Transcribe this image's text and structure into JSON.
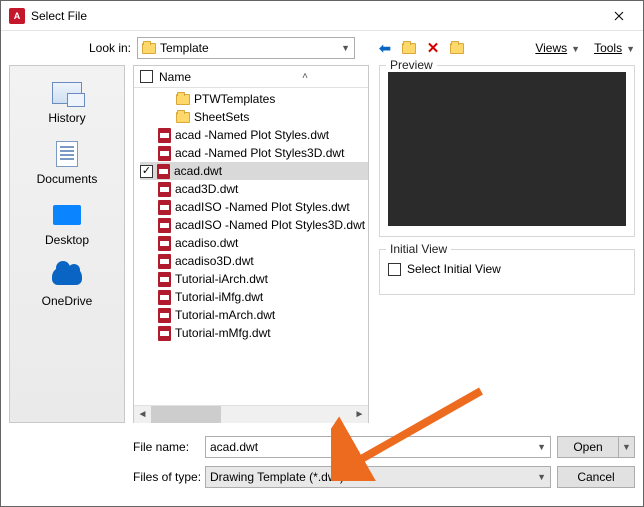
{
  "title": "Select File",
  "lookin_label": "Look in:",
  "lookin_value": "Template",
  "menus": {
    "views": "Views",
    "tools": "Tools"
  },
  "places": [
    {
      "icon": "history-icon",
      "label": "History"
    },
    {
      "icon": "doc-icon",
      "label": "Documents"
    },
    {
      "icon": "desktop-icon",
      "label": "Desktop"
    },
    {
      "icon": "onedrive-icon",
      "label": "OneDrive"
    }
  ],
  "columns": {
    "name": "Name"
  },
  "files": [
    {
      "type": "folder",
      "name": "PTWTemplates",
      "indent": true
    },
    {
      "type": "folder",
      "name": "SheetSets",
      "indent": true
    },
    {
      "type": "dwt",
      "name": "acad -Named Plot Styles.dwt"
    },
    {
      "type": "dwt",
      "name": "acad -Named Plot Styles3D.dwt"
    },
    {
      "type": "dwt",
      "name": "acad.dwt",
      "checked": true,
      "selected": true
    },
    {
      "type": "dwt",
      "name": "acad3D.dwt"
    },
    {
      "type": "dwt",
      "name": "acadISO -Named Plot Styles.dwt"
    },
    {
      "type": "dwt",
      "name": "acadISO -Named Plot Styles3D.dwt"
    },
    {
      "type": "dwt",
      "name": "acadiso.dwt"
    },
    {
      "type": "dwt",
      "name": "acadiso3D.dwt"
    },
    {
      "type": "dwt",
      "name": "Tutorial-iArch.dwt"
    },
    {
      "type": "dwt",
      "name": "Tutorial-iMfg.dwt"
    },
    {
      "type": "dwt",
      "name": "Tutorial-mArch.dwt"
    },
    {
      "type": "dwt",
      "name": "Tutorial-mMfg.dwt"
    }
  ],
  "preview_label": "Preview",
  "initial_view_label": "Initial View",
  "initial_view_checkbox": "Select Initial View",
  "filename_label": "File name:",
  "filename_value": "acad.dwt",
  "filetype_label": "Files of type:",
  "filetype_value": "Drawing Template (*.dwt)",
  "open_label": "Open",
  "cancel_label": "Cancel"
}
